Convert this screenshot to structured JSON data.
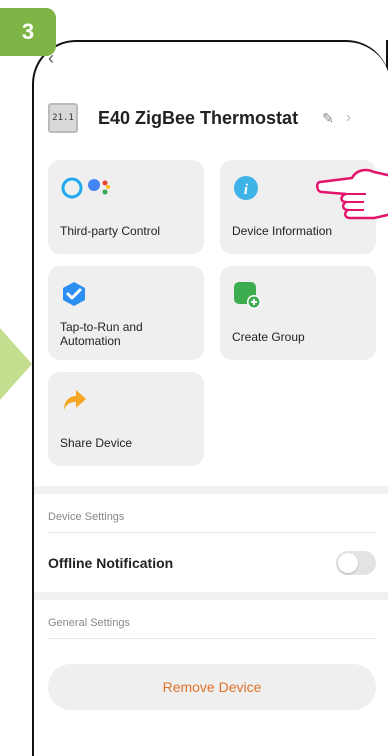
{
  "step": "3",
  "header": {
    "title": "E40 ZigBee Thermostat",
    "device_display": "21.1"
  },
  "cards": [
    {
      "label": "Third-party Control",
      "icon": "assistant-icon"
    },
    {
      "label": "Device Information",
      "icon": "info-icon"
    },
    {
      "label": "Tap-to-Run and Automation",
      "icon": "automation-icon"
    },
    {
      "label": "Create Group",
      "icon": "group-add-icon"
    },
    {
      "label": "Share Device",
      "icon": "share-icon"
    }
  ],
  "sections": {
    "device_settings": "Device Settings",
    "offline_notification": "Offline Notification",
    "general_settings": "General Settings"
  },
  "actions": {
    "remove": "Remove Device"
  },
  "colors": {
    "badge": "#7fb446",
    "pointer": "#e3136b",
    "accent": "#e0722a"
  }
}
